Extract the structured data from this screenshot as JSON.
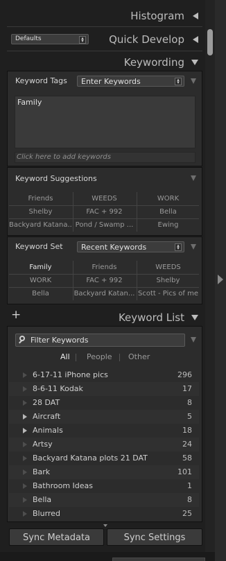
{
  "panels": {
    "histogram": {
      "title": "Histogram"
    },
    "quick_develop": {
      "title": "Quick Develop",
      "preset": "Defaults"
    },
    "keywording": {
      "title": "Keywording",
      "keyword_tags_label": "Keyword Tags",
      "keyword_tags_mode": "Enter Keywords",
      "tags_text": "Family",
      "add_placeholder": "Click here to add keywords",
      "suggestions_label": "Keyword Suggestions",
      "suggestions": [
        "Friends",
        "WEEDS",
        "WORK",
        "Shelby",
        "FAC + 992",
        "Bella",
        "Backyard Katana...",
        "Pond / Swamp ...",
        "Ewing"
      ],
      "keyword_set_label": "Keyword Set",
      "keyword_set_value": "Recent Keywords",
      "keyword_set": [
        "Family",
        "Friends",
        "WEEDS",
        "WORK",
        "FAC + 992",
        "Shelby",
        "Bella",
        "Backyard Katan...",
        "Scott - Pics of me"
      ]
    },
    "keyword_list": {
      "title": "Keyword List",
      "add_symbol": "+",
      "filter_placeholder": "Filter Keywords",
      "filters": [
        "All",
        "People",
        "Other"
      ],
      "items": [
        {
          "name": "6-17-11 iPhone pics",
          "count": "296",
          "expandable": false
        },
        {
          "name": "8-6-11 Kodak",
          "count": "17",
          "expandable": false
        },
        {
          "name": "28 DAT",
          "count": "8",
          "expandable": false
        },
        {
          "name": "Aircraft",
          "count": "5",
          "expandable": true
        },
        {
          "name": "Animals",
          "count": "18",
          "expandable": true
        },
        {
          "name": "Artsy",
          "count": "24",
          "expandable": false
        },
        {
          "name": "Backyard Katana plots 21 DAT",
          "count": "58",
          "expandable": false
        },
        {
          "name": "Bark",
          "count": "101",
          "expandable": false
        },
        {
          "name": "Bathroom Ideas",
          "count": "1",
          "expandable": false
        },
        {
          "name": "Bella",
          "count": "8",
          "expandable": false
        },
        {
          "name": "Blurred",
          "count": "25",
          "expandable": false
        }
      ]
    }
  },
  "buttons": {
    "sync_metadata": "Sync Metadata",
    "sync_settings": "Sync Settings"
  }
}
